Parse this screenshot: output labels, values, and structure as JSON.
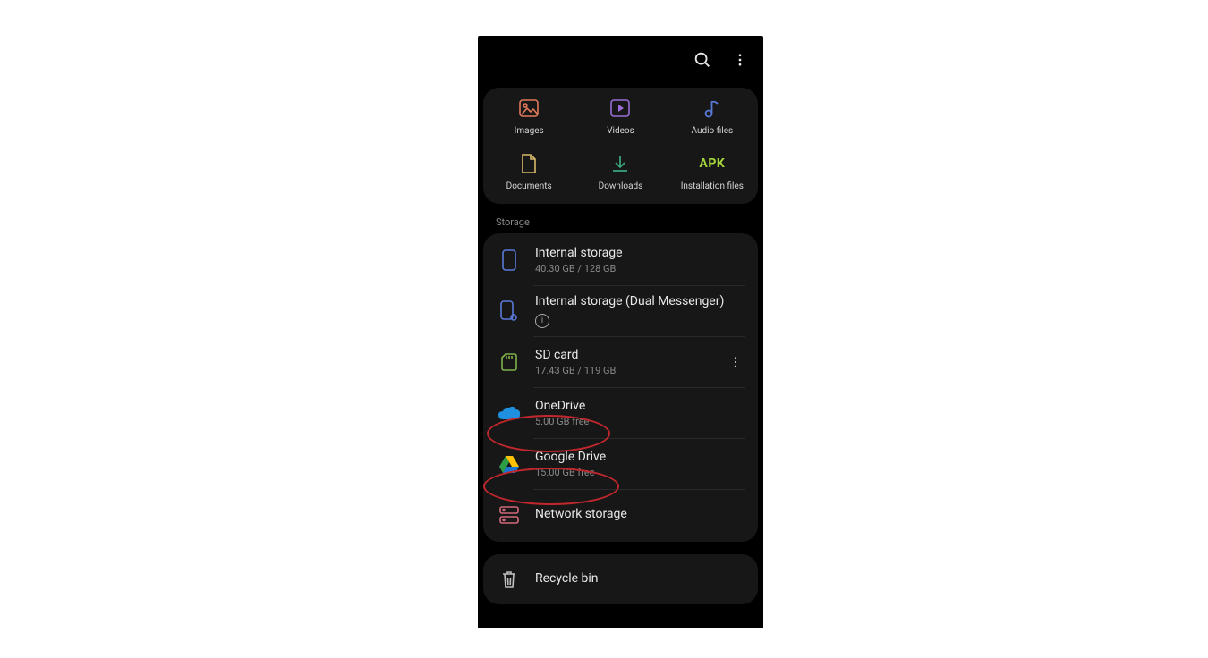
{
  "categories": {
    "images": {
      "label": "Images"
    },
    "videos": {
      "label": "Videos"
    },
    "audio": {
      "label": "Audio files"
    },
    "documents": {
      "label": "Documents"
    },
    "downloads": {
      "label": "Downloads"
    },
    "install": {
      "label": "Installation files",
      "badge": "APK"
    }
  },
  "section_storage": "Storage",
  "storage": {
    "internal": {
      "title": "Internal storage",
      "sub": "40.30 GB / 128 GB"
    },
    "internal_dual": {
      "title": "Internal storage (Dual Messenger)"
    },
    "sdcard": {
      "title": "SD card",
      "sub": "17.43 GB / 119 GB"
    },
    "onedrive": {
      "title": "OneDrive",
      "sub": "5.00 GB free"
    },
    "gdrive": {
      "title": "Google Drive",
      "sub": "15.00 GB free"
    },
    "network": {
      "title": "Network storage"
    }
  },
  "recycle": {
    "title": "Recycle bin"
  }
}
